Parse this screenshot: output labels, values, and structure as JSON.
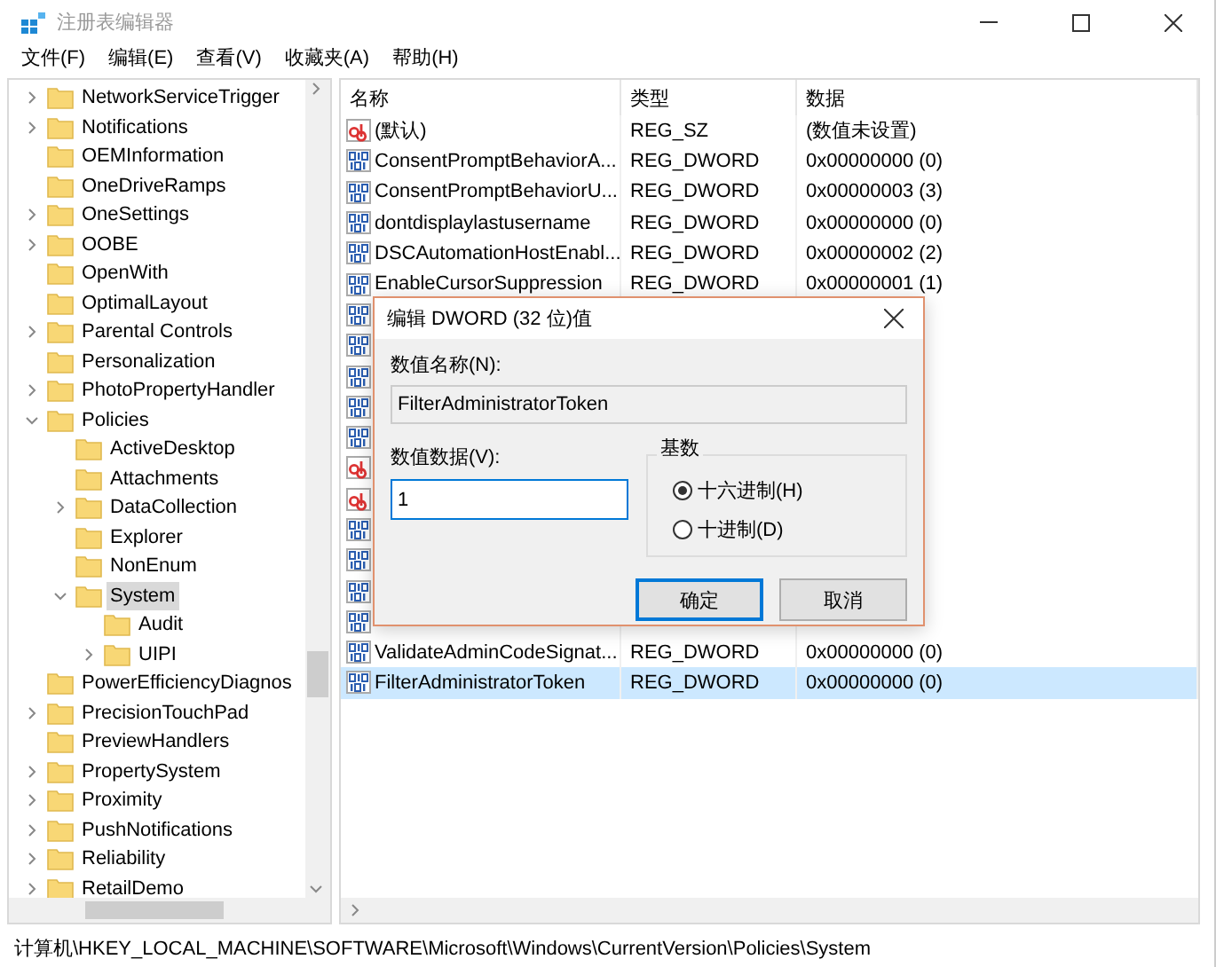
{
  "window": {
    "title": "注册表编辑器"
  },
  "menu": [
    {
      "label": "文件(F)"
    },
    {
      "label": "编辑(E)"
    },
    {
      "label": "查看(V)"
    },
    {
      "label": "收藏夹(A)"
    },
    {
      "label": "帮助(H)"
    }
  ],
  "tree": [
    {
      "label": "NetworkServiceTrigger",
      "expanded": false,
      "selected": false
    },
    {
      "label": "Notifications",
      "expanded": false,
      "selected": false
    },
    {
      "label": "OEMInformation",
      "selected": false
    },
    {
      "label": "OneDriveRamps",
      "selected": false
    },
    {
      "label": "OneSettings",
      "expanded": false,
      "selected": false
    },
    {
      "label": "OOBE",
      "expanded": false,
      "selected": false
    },
    {
      "label": "OpenWith",
      "selected": false
    },
    {
      "label": "OptimalLayout",
      "selected": false
    },
    {
      "label": "Parental Controls",
      "expanded": false,
      "selected": false
    },
    {
      "label": "Personalization",
      "selected": false
    },
    {
      "label": "PhotoPropertyHandler",
      "expanded": false,
      "selected": false
    },
    {
      "label": "Policies",
      "expanded": true,
      "selected": false,
      "children": [
        {
          "label": "ActiveDesktop",
          "selected": false
        },
        {
          "label": "Attachments",
          "selected": false
        },
        {
          "label": "DataCollection",
          "expanded": false,
          "selected": false
        },
        {
          "label": "Explorer",
          "selected": false
        },
        {
          "label": "NonEnum",
          "selected": false
        },
        {
          "label": "System",
          "expanded": true,
          "selected": true,
          "children": [
            {
              "label": "Audit",
              "selected": false
            },
            {
              "label": "UIPI",
              "expanded": false,
              "selected": false
            }
          ]
        }
      ]
    },
    {
      "label": "PowerEfficiencyDiagnos",
      "selected": false
    },
    {
      "label": "PrecisionTouchPad",
      "expanded": false,
      "selected": false
    },
    {
      "label": "PreviewHandlers",
      "selected": false
    },
    {
      "label": "PropertySystem",
      "expanded": false,
      "selected": false
    },
    {
      "label": "Proximity",
      "expanded": false,
      "selected": false
    },
    {
      "label": "PushNotifications",
      "expanded": false,
      "selected": false
    },
    {
      "label": "Reliability",
      "expanded": false,
      "selected": false
    },
    {
      "label": "RetailDemo",
      "expanded": false,
      "selected": false
    }
  ],
  "table": {
    "columns": [
      "名称",
      "类型",
      "数据"
    ],
    "rows": [
      {
        "kind": "string",
        "name": "(默认)",
        "type": "REG_SZ",
        "data": "(数值未设置)",
        "selected": false
      },
      {
        "kind": "dword",
        "name": "ConsentPromptBehaviorA...",
        "type": "REG_DWORD",
        "data": "0x00000000 (0)",
        "selected": false
      },
      {
        "kind": "dword",
        "name": "ConsentPromptBehaviorU...",
        "type": "REG_DWORD",
        "data": "0x00000003 (3)",
        "selected": false
      },
      {
        "kind": "dword",
        "name": "dontdisplaylastusername",
        "type": "REG_DWORD",
        "data": "0x00000000 (0)",
        "selected": false
      },
      {
        "kind": "dword",
        "name": "DSCAutomationHostEnabl...",
        "type": "REG_DWORD",
        "data": "0x00000002 (2)",
        "selected": false
      },
      {
        "kind": "dword",
        "name": "EnableCursorSuppression",
        "type": "REG_DWORD",
        "data": "0x00000001 (1)",
        "selected": false
      },
      {
        "kind": "dword",
        "selected": false
      },
      {
        "kind": "dword",
        "selected": false
      },
      {
        "kind": "dword",
        "selected": false
      },
      {
        "kind": "dword",
        "selected": false
      },
      {
        "kind": "dword",
        "selected": false
      },
      {
        "kind": "string",
        "selected": false
      },
      {
        "kind": "string",
        "selected": false
      },
      {
        "kind": "dword",
        "selected": false
      },
      {
        "kind": "dword",
        "selected": false
      },
      {
        "kind": "dword",
        "selected": false
      },
      {
        "kind": "dword",
        "selected": false
      },
      {
        "kind": "dword",
        "name": "ValidateAdminCodeSignat...",
        "type": "REG_DWORD",
        "data": "0x00000000 (0)",
        "selected": false
      },
      {
        "kind": "dword",
        "name": "FilterAdministratorToken",
        "type": "REG_DWORD",
        "data": "0x00000000 (0)",
        "selected": true
      }
    ]
  },
  "status_bar": "计算机\\HKEY_LOCAL_MACHINE\\SOFTWARE\\Microsoft\\Windows\\CurrentVersion\\Policies\\System",
  "dialog": {
    "title": "编辑 DWORD (32 位)值",
    "name_label": "数值名称(N):",
    "name_value": "FilterAdministratorToken",
    "data_label": "数值数据(V):",
    "data_value": "1",
    "base_label": "基数",
    "bases": [
      {
        "label": "十六进制(H)",
        "selected": true
      },
      {
        "label": "十进制(D)",
        "selected": false
      }
    ],
    "buttons": [
      {
        "label": "确定",
        "default": true
      },
      {
        "label": "取消",
        "default": false
      }
    ]
  }
}
